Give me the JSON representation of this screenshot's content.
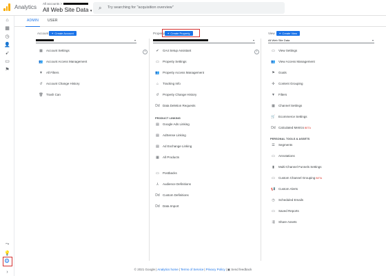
{
  "header": {
    "app_title": "Analytics",
    "account_crumb": "All accounts >",
    "view_selector": "All Web Site Data",
    "search_placeholder": "Try searching for \"acquisition overview\""
  },
  "tabs": [
    {
      "label": "ADMIN",
      "active": true
    },
    {
      "label": "USER",
      "active": false
    }
  ],
  "account": {
    "heading": "Account",
    "create_label": "Create Account",
    "items": [
      {
        "icon": "building-icon",
        "glyph": "▦",
        "label": "Account Settings"
      },
      {
        "icon": "people-icon",
        "glyph": "👥",
        "label": "Account Access Management"
      },
      {
        "icon": "filter-icon",
        "glyph": "▼",
        "label": "All Filters"
      },
      {
        "icon": "history-icon",
        "glyph": "↺",
        "label": "Account Change History"
      },
      {
        "icon": "trash-icon",
        "glyph": "🗑",
        "label": "Trash Can"
      }
    ]
  },
  "property": {
    "heading": "Property",
    "create_label": "Create Property",
    "items": [
      {
        "icon": "check-icon",
        "glyph": "✔",
        "label": "GA4 Setup Assistant"
      },
      {
        "icon": "settings-icon",
        "glyph": "▭",
        "label": "Property Settings"
      },
      {
        "icon": "people-icon",
        "glyph": "👥",
        "label": "Property Access Management"
      },
      {
        "icon": "code-icon",
        "glyph": "⌂",
        "label": "Tracking Info"
      },
      {
        "icon": "history-icon",
        "glyph": "↺",
        "label": "Property Change History"
      },
      {
        "icon": "dd-icon",
        "glyph": "Dd",
        "label": "Data Deletion Requests"
      }
    ],
    "product_linking_heading": "PRODUCT LINKING",
    "linking_items": [
      {
        "icon": "ads-icon",
        "glyph": "▤",
        "label": "Google Ads Linking"
      },
      {
        "icon": "adsense-icon",
        "glyph": "▤",
        "label": "AdSense Linking"
      },
      {
        "icon": "adexchange-icon",
        "glyph": "▤",
        "label": "Ad Exchange Linking"
      },
      {
        "icon": "products-icon",
        "glyph": "▦",
        "label": "All Products"
      }
    ],
    "other_items": [
      {
        "icon": "postbacks-icon",
        "glyph": "▭",
        "label": "Postbacks"
      },
      {
        "icon": "audience-icon",
        "glyph": "⅄",
        "label": "Audience Definitions"
      },
      {
        "icon": "dd-icon",
        "glyph": "Dd",
        "label": "Custom Definitions"
      },
      {
        "icon": "dd-icon",
        "glyph": "Dd",
        "label": "Data Import"
      }
    ]
  },
  "view": {
    "heading": "View",
    "create_label": "Create View",
    "selected": "All Web Site Data",
    "items": [
      {
        "icon": "settings-icon",
        "glyph": "▭",
        "label": "View Settings",
        "beta": ""
      },
      {
        "icon": "people-icon",
        "glyph": "👥",
        "label": "View Access Management",
        "beta": ""
      },
      {
        "icon": "flag-icon",
        "glyph": "⚑",
        "label": "Goals",
        "beta": ""
      },
      {
        "icon": "grouping-icon",
        "glyph": "✣",
        "label": "Content Grouping",
        "beta": ""
      },
      {
        "icon": "filter-icon",
        "glyph": "▼",
        "label": "Filters",
        "beta": ""
      },
      {
        "icon": "channel-icon",
        "glyph": "▦",
        "label": "Channel Settings",
        "beta": ""
      },
      {
        "icon": "cart-icon",
        "glyph": "🛒",
        "label": "Ecommerce Settings",
        "beta": ""
      },
      {
        "icon": "dd-icon",
        "glyph": "Dd",
        "label": "Calculated Metrics",
        "beta": "BETA"
      }
    ],
    "personal_heading": "PERSONAL TOOLS & ASSETS",
    "personal_items": [
      {
        "icon": "segments-icon",
        "glyph": "☰",
        "label": "Segments",
        "beta": ""
      },
      {
        "icon": "annotations-icon",
        "glyph": "▭",
        "label": "Annotations",
        "beta": ""
      },
      {
        "icon": "funnel-icon",
        "glyph": "▮",
        "label": "Multi-Channel Funnels Settings",
        "beta": ""
      },
      {
        "icon": "channel-grouping-icon",
        "glyph": "▭",
        "label": "Custom Channel Grouping",
        "beta": "BETA"
      },
      {
        "icon": "alerts-icon",
        "glyph": "📢",
        "label": "Custom Alerts",
        "beta": ""
      },
      {
        "icon": "email-icon",
        "glyph": "◷",
        "label": "Scheduled Emails",
        "beta": ""
      },
      {
        "icon": "saved-icon",
        "glyph": "▭",
        "label": "Saved Reports",
        "beta": ""
      },
      {
        "icon": "share-icon",
        "glyph": "⇶",
        "label": "Share Assets",
        "beta": ""
      }
    ]
  },
  "footer": {
    "copyright": "© 2021 Google",
    "link1": "Analytics home",
    "link2": "Terms of Service",
    "link3": "Privacy Policy",
    "feedback": "Send feedback"
  },
  "colors": {
    "accent": "#1a73e8",
    "highlight": "#d32f2f",
    "brand": "#f9ab00"
  }
}
